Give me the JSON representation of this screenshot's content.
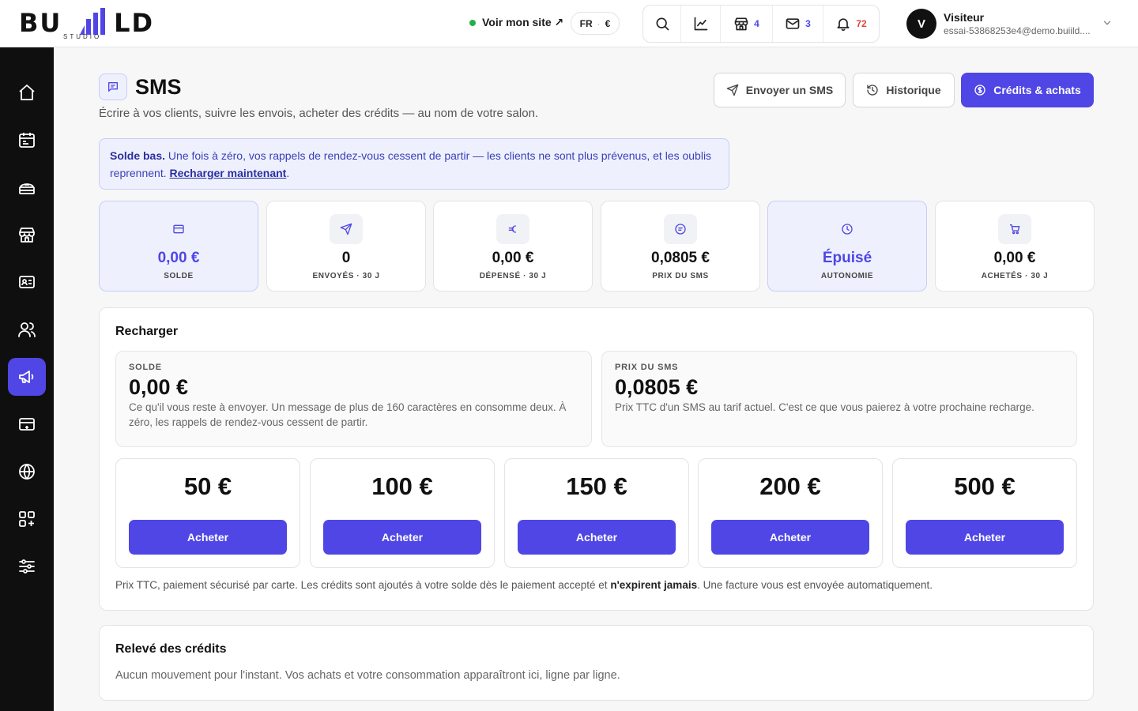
{
  "brand": {
    "logo_main": "BU LD",
    "logo_sub": "STUDIO"
  },
  "topbar": {
    "site_link": "Voir mon site ↗",
    "language": "FR",
    "currency": "€",
    "shop_count": "4",
    "mail_count": "3",
    "notif_count": "72",
    "user_initial": "V",
    "user_name": "Visiteur",
    "user_email": "essai-53868253e4@demo.buiild...."
  },
  "header": {
    "title": "SMS",
    "subtitle": "Écrire à vos clients, suivre les envois, acheter des crédits — au nom de votre salon.",
    "btn_send": "Envoyer un SMS",
    "btn_history": "Historique",
    "btn_credits": "Crédits & achats"
  },
  "alert": {
    "strong": "Solde bas.",
    "text": " Une fois à zéro, vos rappels de rendez-vous cessent de partir — les clients ne sont plus prévenus, et les oublis reprennent. ",
    "link": "Recharger maintenant",
    "end": "."
  },
  "stats": [
    {
      "value": "0,00 €",
      "label": "SOLDE",
      "icon": "card-icon"
    },
    {
      "value": "0",
      "label": "ENVOYÉS · 30 J",
      "icon": "send-icon"
    },
    {
      "value": "0,00 €",
      "label": "DÉPENSÉ · 30 J",
      "icon": "euro-icon"
    },
    {
      "value": "0,0805 €",
      "label": "PRIX DU SMS",
      "icon": "message-icon"
    },
    {
      "value": "Épuisé",
      "label": "AUTONOMIE",
      "icon": "clock-icon"
    },
    {
      "value": "0,00 €",
      "label": "ACHETÉS · 30 J",
      "icon": "cart-icon"
    }
  ],
  "recharge": {
    "title": "Recharger",
    "balance_label": "SOLDE",
    "balance_value": "0,00 €",
    "balance_desc": "Ce qu'il vous reste à envoyer. Un message de plus de 160 caractères en consomme deux. À zéro, les rappels de rendez-vous cessent de partir.",
    "price_label": "PRIX DU SMS",
    "price_value": "0,0805 €",
    "price_desc": "Prix TTC d'un SMS au tarif actuel. C'est ce que vous paierez à votre prochaine recharge.",
    "packs": [
      {
        "amount": "50 €",
        "button": "Acheter"
      },
      {
        "amount": "100 €",
        "button": "Acheter"
      },
      {
        "amount": "150 €",
        "button": "Acheter"
      },
      {
        "amount": "200 €",
        "button": "Acheter"
      },
      {
        "amount": "500 €",
        "button": "Acheter"
      }
    ],
    "footnote_start": "Prix TTC, paiement sécurisé par carte. Les crédits sont ajoutés à votre solde dès le paiement accepté et ",
    "footnote_bold": "n'expirent jamais",
    "footnote_end": ". Une facture vous est envoyée automatiquement."
  },
  "statement": {
    "title": "Relevé des crédits",
    "empty": "Aucun mouvement pour l'instant. Vos achats et votre consommation apparaîtront ici, ligne par ligne."
  },
  "colors": {
    "accent": "#4f46e5",
    "sidebar": "#0f0f10",
    "status_online": "#22b04b",
    "notif": "#e0453a"
  }
}
